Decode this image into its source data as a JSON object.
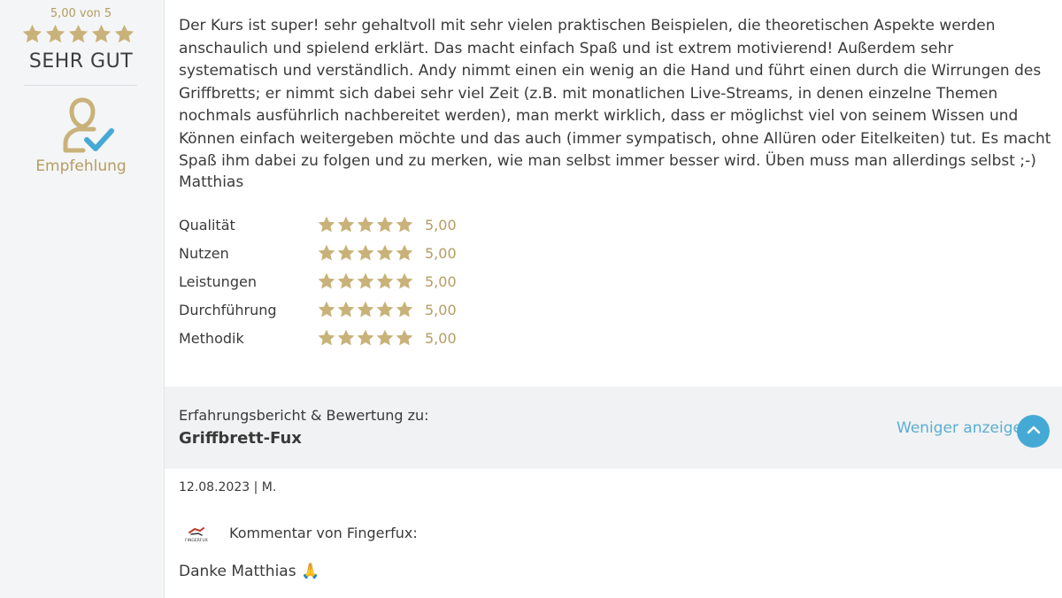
{
  "summary": {
    "score_text": "5,00 von 5",
    "grade": "SEHR GUT",
    "stars": 5,
    "recommendation_label": "Empfehlung"
  },
  "review": {
    "text": "Der Kurs ist super! sehr gehaltvoll mit sehr vielen praktischen Beispielen, die theoretischen Aspekte werden anschaulich und spielend erklärt. Das macht einfach Spaß und ist extrem motivierend! Außerdem sehr systematisch und verständlich. Andy nimmt einen ein wenig an die Hand und führt einen durch die Wirrungen des Griffbretts; er nimmt sich dabei sehr viel Zeit (z.B. mit monatlichen Live-Streams, in denen einzelne Themen nochmals ausführlich nachbereitet werden), man merkt wirklich, dass er möglichst viel von seinem Wissen und Können einfach weitergeben möchte und das auch (immer sympatisch, ohne Allüren oder Eitelkeiten) tut. Es macht Spaß ihm dabei zu folgen und zu merken, wie man selbst immer besser wird. Üben muss man allerdings selbst ;-)",
    "author": "Matthias"
  },
  "ratings": [
    {
      "label": "Qualität",
      "stars": 5,
      "value": "5,00"
    },
    {
      "label": "Nutzen",
      "stars": 5,
      "value": "5,00"
    },
    {
      "label": "Leistungen",
      "stars": 5,
      "value": "5,00"
    },
    {
      "label": "Durchführung",
      "stars": 5,
      "value": "5,00"
    },
    {
      "label": "Methodik",
      "stars": 5,
      "value": "5,00"
    }
  ],
  "info": {
    "intro": "Erfahrungsbericht & Bewertung zu:",
    "course": "Griffbrett-Fux",
    "less_link": "Weniger anzeigen",
    "collapse_icon": "chevron-up-icon"
  },
  "meta": "12.08.2023 | M.",
  "comment": {
    "logo_text": "FINGERFUX",
    "title": "Kommentar von Fingerfux:",
    "body": "Danke Matthias 🙏"
  },
  "colors": {
    "gold": "#b59c62",
    "star": "#c9b27a",
    "accent_blue": "#45a9d5",
    "link_blue": "#5aaed1",
    "sidebar_bg": "#f4f5f6"
  }
}
